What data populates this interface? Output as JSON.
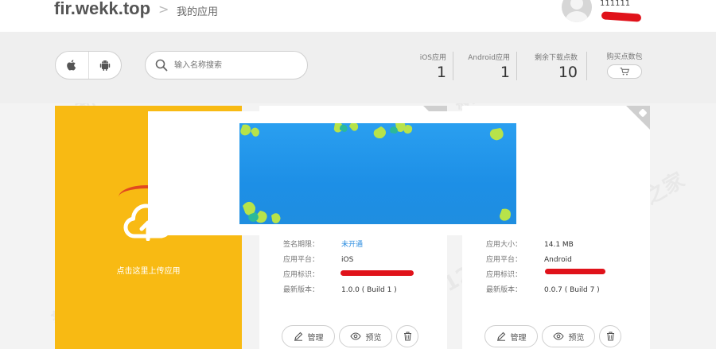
{
  "header": {
    "brand": "fir.wekk.top",
    "separator": ">",
    "breadcrumb": "我的应用",
    "username": "111111"
  },
  "toolbar": {
    "search_placeholder": "输入名称搜索",
    "stats": [
      {
        "label": "iOS应用",
        "value": "1"
      },
      {
        "label": "Android应用",
        "value": "1"
      },
      {
        "label": "剩余下载点数",
        "value": "10"
      }
    ],
    "buy_label": "购买点数包"
  },
  "upload": {
    "label": "点击这里上传应用"
  },
  "apps": [
    {
      "platform_icon": "apple-icon",
      "rows": [
        {
          "key": "签名期限：",
          "value": "未开通",
          "link": true
        },
        {
          "key": "应用平台：",
          "value": "iOS"
        },
        {
          "key": "应用标识：",
          "value": ""
        },
        {
          "key": "最新版本：",
          "value": "1.0.0 ( Build 1 )"
        }
      ],
      "actions": {
        "manage": "管理",
        "preview": "预览"
      }
    },
    {
      "platform_icon": "android-icon",
      "rows": [
        {
          "key": "应用大小：",
          "value": "14.1 MB"
        },
        {
          "key": "应用平台：",
          "value": "Android"
        },
        {
          "key": "应用标识：",
          "value": ""
        },
        {
          "key": "最新版本：",
          "value": "0.0.7 ( Build 7 )"
        }
      ],
      "actions": {
        "manage": "管理",
        "preview": "预览"
      }
    }
  ],
  "watermark_text": "新云之家",
  "colors": {
    "upload_bg": "#f8ba13",
    "link": "#2a8ce0",
    "redaction": "#e0121a",
    "banner": "#1d8fe6"
  }
}
